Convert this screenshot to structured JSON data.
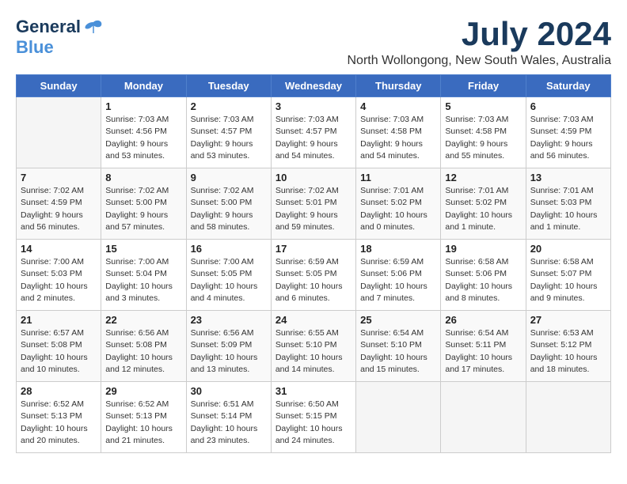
{
  "header": {
    "logo_line1": "General",
    "logo_line2": "Blue",
    "month_year": "July 2024",
    "location": "North Wollongong, New South Wales, Australia"
  },
  "weekdays": [
    "Sunday",
    "Monday",
    "Tuesday",
    "Wednesday",
    "Thursday",
    "Friday",
    "Saturday"
  ],
  "weeks": [
    [
      {
        "day": "",
        "sunrise": "",
        "sunset": "",
        "daylight": ""
      },
      {
        "day": "1",
        "sunrise": "Sunrise: 7:03 AM",
        "sunset": "Sunset: 4:56 PM",
        "daylight": "Daylight: 9 hours and 53 minutes."
      },
      {
        "day": "2",
        "sunrise": "Sunrise: 7:03 AM",
        "sunset": "Sunset: 4:57 PM",
        "daylight": "Daylight: 9 hours and 53 minutes."
      },
      {
        "day": "3",
        "sunrise": "Sunrise: 7:03 AM",
        "sunset": "Sunset: 4:57 PM",
        "daylight": "Daylight: 9 hours and 54 minutes."
      },
      {
        "day": "4",
        "sunrise": "Sunrise: 7:03 AM",
        "sunset": "Sunset: 4:58 PM",
        "daylight": "Daylight: 9 hours and 54 minutes."
      },
      {
        "day": "5",
        "sunrise": "Sunrise: 7:03 AM",
        "sunset": "Sunset: 4:58 PM",
        "daylight": "Daylight: 9 hours and 55 minutes."
      },
      {
        "day": "6",
        "sunrise": "Sunrise: 7:03 AM",
        "sunset": "Sunset: 4:59 PM",
        "daylight": "Daylight: 9 hours and 56 minutes."
      }
    ],
    [
      {
        "day": "7",
        "sunrise": "Sunrise: 7:02 AM",
        "sunset": "Sunset: 4:59 PM",
        "daylight": "Daylight: 9 hours and 56 minutes."
      },
      {
        "day": "8",
        "sunrise": "Sunrise: 7:02 AM",
        "sunset": "Sunset: 5:00 PM",
        "daylight": "Daylight: 9 hours and 57 minutes."
      },
      {
        "day": "9",
        "sunrise": "Sunrise: 7:02 AM",
        "sunset": "Sunset: 5:00 PM",
        "daylight": "Daylight: 9 hours and 58 minutes."
      },
      {
        "day": "10",
        "sunrise": "Sunrise: 7:02 AM",
        "sunset": "Sunset: 5:01 PM",
        "daylight": "Daylight: 9 hours and 59 minutes."
      },
      {
        "day": "11",
        "sunrise": "Sunrise: 7:01 AM",
        "sunset": "Sunset: 5:02 PM",
        "daylight": "Daylight: 10 hours and 0 minutes."
      },
      {
        "day": "12",
        "sunrise": "Sunrise: 7:01 AM",
        "sunset": "Sunset: 5:02 PM",
        "daylight": "Daylight: 10 hours and 1 minute."
      },
      {
        "day": "13",
        "sunrise": "Sunrise: 7:01 AM",
        "sunset": "Sunset: 5:03 PM",
        "daylight": "Daylight: 10 hours and 1 minute."
      }
    ],
    [
      {
        "day": "14",
        "sunrise": "Sunrise: 7:00 AM",
        "sunset": "Sunset: 5:03 PM",
        "daylight": "Daylight: 10 hours and 2 minutes."
      },
      {
        "day": "15",
        "sunrise": "Sunrise: 7:00 AM",
        "sunset": "Sunset: 5:04 PM",
        "daylight": "Daylight: 10 hours and 3 minutes."
      },
      {
        "day": "16",
        "sunrise": "Sunrise: 7:00 AM",
        "sunset": "Sunset: 5:05 PM",
        "daylight": "Daylight: 10 hours and 4 minutes."
      },
      {
        "day": "17",
        "sunrise": "Sunrise: 6:59 AM",
        "sunset": "Sunset: 5:05 PM",
        "daylight": "Daylight: 10 hours and 6 minutes."
      },
      {
        "day": "18",
        "sunrise": "Sunrise: 6:59 AM",
        "sunset": "Sunset: 5:06 PM",
        "daylight": "Daylight: 10 hours and 7 minutes."
      },
      {
        "day": "19",
        "sunrise": "Sunrise: 6:58 AM",
        "sunset": "Sunset: 5:06 PM",
        "daylight": "Daylight: 10 hours and 8 minutes."
      },
      {
        "day": "20",
        "sunrise": "Sunrise: 6:58 AM",
        "sunset": "Sunset: 5:07 PM",
        "daylight": "Daylight: 10 hours and 9 minutes."
      }
    ],
    [
      {
        "day": "21",
        "sunrise": "Sunrise: 6:57 AM",
        "sunset": "Sunset: 5:08 PM",
        "daylight": "Daylight: 10 hours and 10 minutes."
      },
      {
        "day": "22",
        "sunrise": "Sunrise: 6:56 AM",
        "sunset": "Sunset: 5:08 PM",
        "daylight": "Daylight: 10 hours and 12 minutes."
      },
      {
        "day": "23",
        "sunrise": "Sunrise: 6:56 AM",
        "sunset": "Sunset: 5:09 PM",
        "daylight": "Daylight: 10 hours and 13 minutes."
      },
      {
        "day": "24",
        "sunrise": "Sunrise: 6:55 AM",
        "sunset": "Sunset: 5:10 PM",
        "daylight": "Daylight: 10 hours and 14 minutes."
      },
      {
        "day": "25",
        "sunrise": "Sunrise: 6:54 AM",
        "sunset": "Sunset: 5:10 PM",
        "daylight": "Daylight: 10 hours and 15 minutes."
      },
      {
        "day": "26",
        "sunrise": "Sunrise: 6:54 AM",
        "sunset": "Sunset: 5:11 PM",
        "daylight": "Daylight: 10 hours and 17 minutes."
      },
      {
        "day": "27",
        "sunrise": "Sunrise: 6:53 AM",
        "sunset": "Sunset: 5:12 PM",
        "daylight": "Daylight: 10 hours and 18 minutes."
      }
    ],
    [
      {
        "day": "28",
        "sunrise": "Sunrise: 6:52 AM",
        "sunset": "Sunset: 5:13 PM",
        "daylight": "Daylight: 10 hours and 20 minutes."
      },
      {
        "day": "29",
        "sunrise": "Sunrise: 6:52 AM",
        "sunset": "Sunset: 5:13 PM",
        "daylight": "Daylight: 10 hours and 21 minutes."
      },
      {
        "day": "30",
        "sunrise": "Sunrise: 6:51 AM",
        "sunset": "Sunset: 5:14 PM",
        "daylight": "Daylight: 10 hours and 23 minutes."
      },
      {
        "day": "31",
        "sunrise": "Sunrise: 6:50 AM",
        "sunset": "Sunset: 5:15 PM",
        "daylight": "Daylight: 10 hours and 24 minutes."
      },
      {
        "day": "",
        "sunrise": "",
        "sunset": "",
        "daylight": ""
      },
      {
        "day": "",
        "sunrise": "",
        "sunset": "",
        "daylight": ""
      },
      {
        "day": "",
        "sunrise": "",
        "sunset": "",
        "daylight": ""
      }
    ]
  ]
}
